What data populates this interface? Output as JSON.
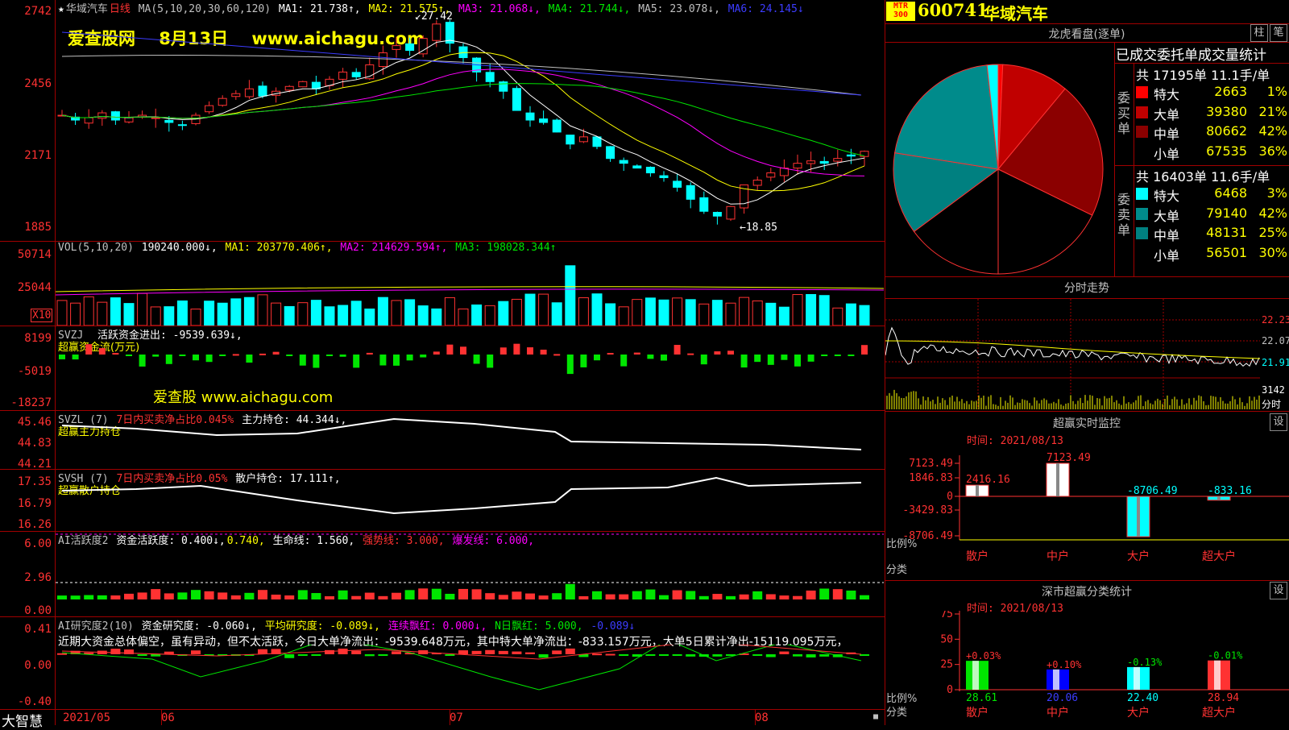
{
  "stock": {
    "code": "600741",
    "name": "华域汽车",
    "badge": "MTR 300"
  },
  "watermark_top": {
    "site": "爱查股网",
    "date": "8月13日",
    "url": "www.aichagu.com"
  },
  "watermark_mid": "爱查股 www.aichagu.com",
  "main_panel": {
    "title_star": "★",
    "title_name": "华域汽车",
    "title_period": "日线",
    "ma_label": "MA(5,10,20,30,60,120)",
    "ma1": "MA1: 21.738↑,",
    "ma2": "MA2: 21.575↑,",
    "ma3": "MA3: 21.068↓,",
    "ma4": "MA4: 21.744↓,",
    "ma5": "MA5: 23.078↓,",
    "ma6": "MA6: 24.145↓",
    "y_ticks": [
      "2742",
      "2456",
      "2171",
      "1885"
    ],
    "high_label": "27.42",
    "low_label": "18.85"
  },
  "vol_panel": {
    "title": "VOL(5,10,20)",
    "value": "190240.000↓,",
    "ma1": "MA1: 203770.406↑,",
    "ma2": "MA2: 214629.594↑,",
    "ma3": "MA3: 198028.344↑",
    "y_ticks": [
      "50714",
      "25044"
    ],
    "unit": "X10"
  },
  "svzj_panel": {
    "title": "SVZJ",
    "line1": "活跃资金进出: -9539.639↓,",
    "line2": "超赢资金流(万元)",
    "y_ticks": [
      "8199",
      "-5019",
      "-18237"
    ]
  },
  "svzl_panel": {
    "title": "SVZL (7)",
    "line1": "7日内买卖净占比0.045%",
    "line2": "主力持仓: 44.344↓,",
    "line3": "超赢主力持仓",
    "y_ticks": [
      "45.46",
      "44.83",
      "44.21"
    ]
  },
  "svsh_panel": {
    "title": "SVSH (7)",
    "line1": "7日内买卖净占比0.05%",
    "line2": "散户持仓: 17.111↑,",
    "line3": "超赢散户持仓",
    "y_ticks": [
      "17.35",
      "16.79",
      "16.26"
    ]
  },
  "ai_active_panel": {
    "title": "AI活跃度2",
    "l1": "资金活跃度: 0.400↓,",
    "l2": "0.740,",
    "l3": "生命线: 1.560,",
    "l4": "强势线: 3.000,",
    "l5": "爆发线: 6.000,",
    "y_ticks": [
      "6.00",
      "2.96",
      "0.00"
    ]
  },
  "ai_research_panel": {
    "title": "AI研究度2(10)",
    "l1": "资金研究度: -0.060↓,",
    "l2": "平均研究度: -0.089↓,",
    "l3": "连续飘红: 0.000↓,",
    "l4": "N日飘红: 5.000,",
    "l5": "-0.089↓",
    "comment": "近期大资金总体偏空，虽有异动，但不太活跃，今日大单净流出：-9539.648万元，其中特大单净流出：-833.157万元，大单5日累计净出-15119.095万元，",
    "y_ticks": [
      "0.41",
      "0.00",
      "-0.40"
    ]
  },
  "x_axis": {
    "brand": "大智慧",
    "labels": [
      "2021/05",
      "06",
      "07",
      "08"
    ]
  },
  "right": {
    "longhu_title": "龙虎看盘(逐单)",
    "btn_zhu": "柱",
    "btn_bi": "笔",
    "stats_title": "已成交委托单成交量统计",
    "buy": {
      "side": "委买单",
      "summary": "共 17195单 11.1手/单",
      "rows": [
        {
          "label": "特大",
          "value": "2663",
          "pct": "1%",
          "color": "#ff0000"
        },
        {
          "label": "大单",
          "value": "39380",
          "pct": "21%",
          "color": "#c00000"
        },
        {
          "label": "中单",
          "value": "80662",
          "pct": "42%",
          "color": "#8b0000"
        },
        {
          "label": "小单",
          "value": "67535",
          "pct": "36%",
          "color": "#000000"
        }
      ]
    },
    "sell": {
      "side": "委卖单",
      "summary": "共 16403单 11.6手/单",
      "rows": [
        {
          "label": "特大",
          "value": "6468",
          "pct": "3%",
          "color": "#00ffff"
        },
        {
          "label": "大单",
          "value": "79140",
          "pct": "42%",
          "color": "#008b8b"
        },
        {
          "label": "中单",
          "value": "48131",
          "pct": "25%",
          "color": "#008080"
        },
        {
          "label": "小单",
          "value": "56501",
          "pct": "30%",
          "color": "#000000"
        }
      ]
    },
    "intraday": {
      "title": "分时走势",
      "y_ticks": [
        "22.23",
        "22.07",
        "21.91",
        "3142"
      ],
      "bottom": "分时"
    },
    "monitor": {
      "title": "超赢实时监控",
      "btn": "设",
      "time": "时间: 2021/08/13",
      "y_ticks": [
        "7123.49",
        "1846.83",
        "0",
        "-3429.83",
        "-8706.49"
      ],
      "bars": [
        {
          "cat": "散户",
          "value": 2416.16,
          "label": "2416.16"
        },
        {
          "cat": "中户",
          "value": 7123.49,
          "label": "7123.49"
        },
        {
          "cat": "大户",
          "value": -8706.49,
          "label": "-8706.49"
        },
        {
          "cat": "超大户",
          "value": -833.16,
          "label": "-833.16"
        }
      ],
      "ratio_label": "比例%",
      "cat_label": "分类"
    },
    "classify": {
      "title": "深市超赢分类统计",
      "btn": "设",
      "time": "时间: 2021/08/13",
      "y_ticks": [
        "75",
        "50",
        "25",
        "0"
      ],
      "bars": [
        {
          "cat": "散户",
          "value": 28.61,
          "change": "+0.03%"
        },
        {
          "cat": "中户",
          "value": 20.06,
          "change": "+0.10%"
        },
        {
          "cat": "大户",
          "value": 22.4,
          "change": "-0.13%"
        },
        {
          "cat": "超大户",
          "value": 28.94,
          "change": "-0.01%"
        }
      ],
      "ratio_label": "比例%",
      "cat_label": "分类"
    }
  }
}
